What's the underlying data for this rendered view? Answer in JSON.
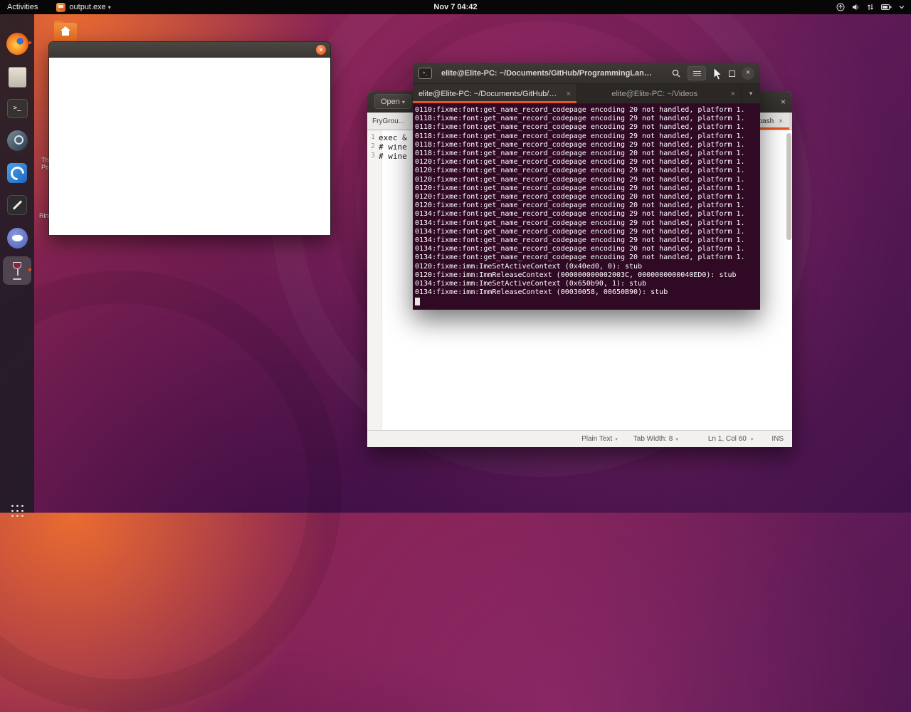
{
  "colors": {
    "accent": "#e95420",
    "terminal_bg": "#300a24"
  },
  "topbar": {
    "activities": "Activities",
    "app_menu": "output.exe",
    "clock": "Nov 7 04:42"
  },
  "desktop": {
    "fragments": [
      "Th",
      "Poly",
      "Rin"
    ]
  },
  "dock": {
    "items": [
      "firefox",
      "files",
      "terminal",
      "steam",
      "blue-app",
      "text-editor",
      "discord",
      "wine",
      "app-grid"
    ]
  },
  "output_window": {
    "title": ""
  },
  "terminal": {
    "title": "elite@Elite-PC: ~/Documents/GitHub/ProgrammingLanguag...",
    "tabs": [
      {
        "label": "elite@Elite-PC: ~/Documents/GitHub/Pr..."
      },
      {
        "label": "elite@Elite-PC: ~/Videos"
      }
    ],
    "lines": [
      "0110:fixme:font:get_name_record_codepage encoding 20 not handled, platform 1.",
      "0118:fixme:font:get_name_record_codepage encoding 29 not handled, platform 1.",
      "0118:fixme:font:get_name_record_codepage encoding 29 not handled, platform 1.",
      "0118:fixme:font:get_name_record_codepage encoding 29 not handled, platform 1.",
      "0118:fixme:font:get_name_record_codepage encoding 29 not handled, platform 1.",
      "0118:fixme:font:get_name_record_codepage encoding 20 not handled, platform 1.",
      "0120:fixme:font:get_name_record_codepage encoding 29 not handled, platform 1.",
      "0120:fixme:font:get_name_record_codepage encoding 29 not handled, platform 1.",
      "0120:fixme:font:get_name_record_codepage encoding 29 not handled, platform 1.",
      "0120:fixme:font:get_name_record_codepage encoding 29 not handled, platform 1.",
      "0120:fixme:font:get_name_record_codepage encoding 20 not handled, platform 1.",
      "0120:fixme:font:get_name_record_codepage encoding 20 not handled, platform 1.",
      "0134:fixme:font:get_name_record_codepage encoding 29 not handled, platform 1.",
      "0134:fixme:font:get_name_record_codepage encoding 29 not handled, platform 1.",
      "0134:fixme:font:get_name_record_codepage encoding 29 not handled, platform 1.",
      "0134:fixme:font:get_name_record_codepage encoding 29 not handled, platform 1.",
      "0134:fixme:font:get_name_record_codepage encoding 20 not handled, platform 1.",
      "0134:fixme:font:get_name_record_codepage encoding 20 not handled, platform 1.",
      "0120:fixme:imm:ImeSetActiveContext (0x40ed0, 0): stub",
      "0120:fixme:imm:ImmReleaseContext (000000000002003C, 0000000000040ED0): stub",
      "0134:fixme:imm:ImeSetActiveContext (0x650b90, 1): stub",
      "0134:fixme:imm:ImmReleaseContext (00030058, 00650B90): stub"
    ]
  },
  "editor": {
    "open_label": "Open",
    "doc_tab": "FryGrou...",
    "side_tab": "bash",
    "lines": [
      {
        "n": "1",
        "text": "exec &"
      },
      {
        "n": "2",
        "text": "# wine"
      },
      {
        "n": "3",
        "text": "# wine"
      }
    ],
    "status": {
      "language": "Plain Text",
      "tab_width": "Tab Width: 8",
      "position": "Ln 1, Col 60",
      "mode": "INS"
    }
  }
}
